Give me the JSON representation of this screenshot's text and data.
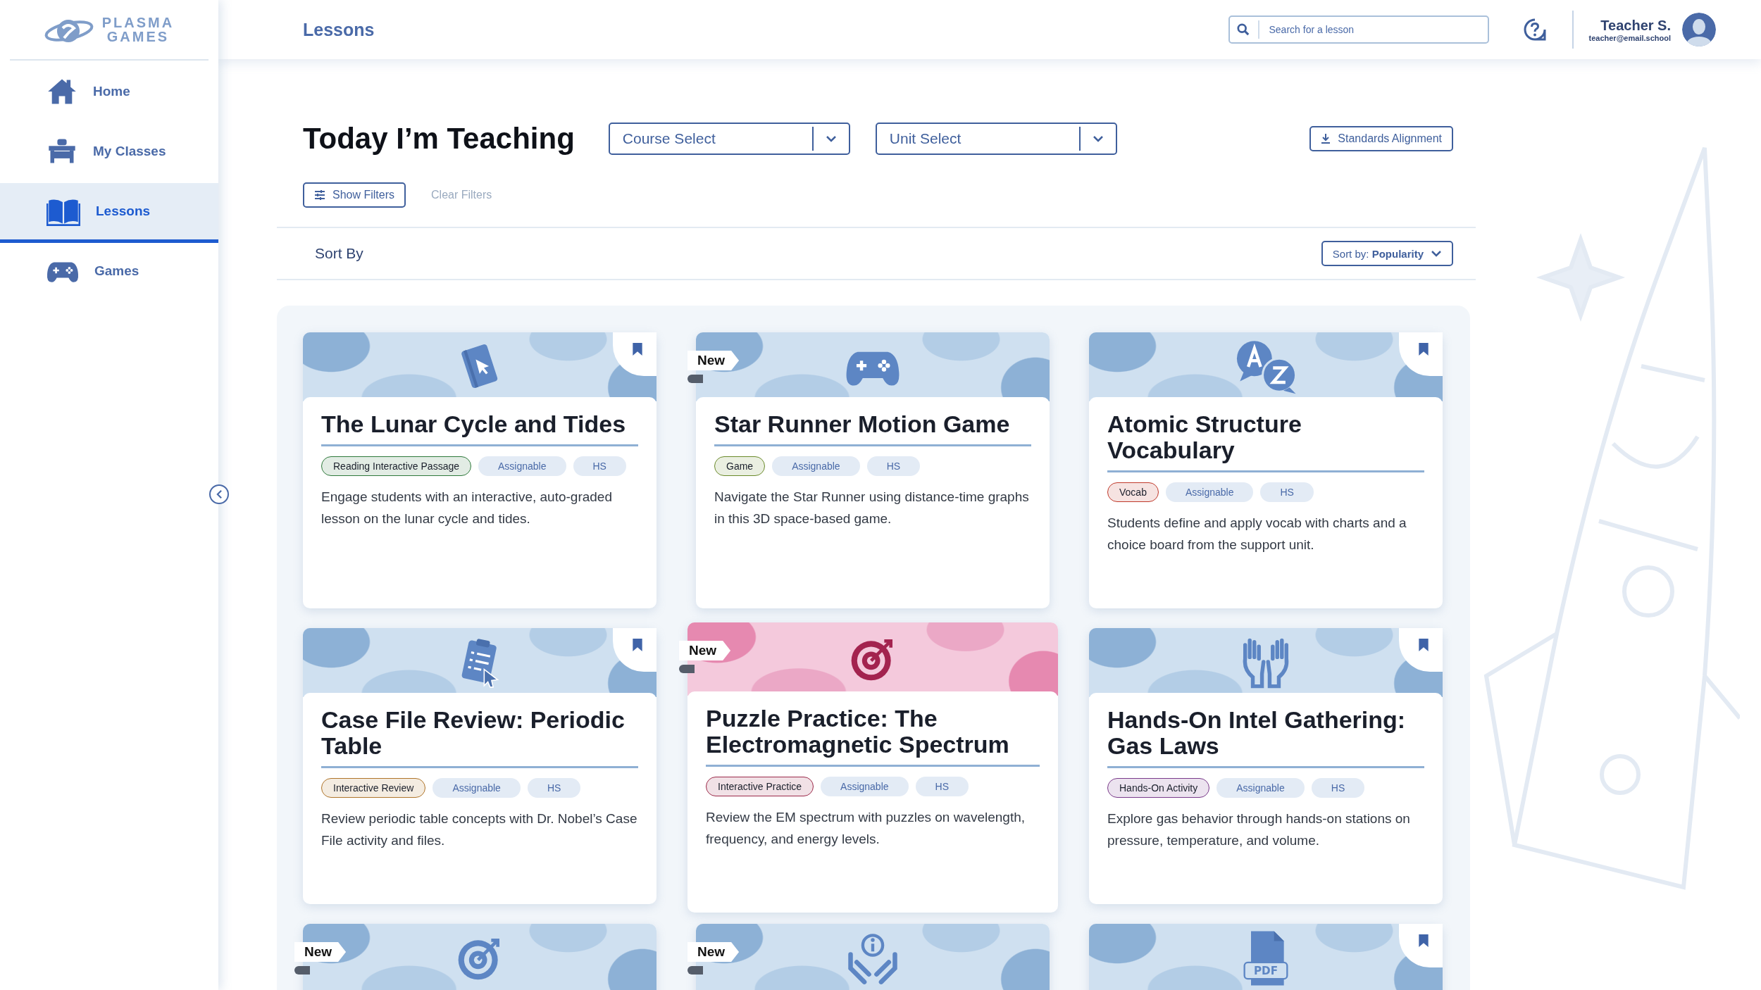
{
  "sidebar": {
    "brand": {
      "line_1": "PLASMA",
      "line_2": "GAMES"
    },
    "items": [
      {
        "label": "Home",
        "kind": "home",
        "selected": false
      },
      {
        "label": "My Classes",
        "kind": "desk",
        "selected": false
      },
      {
        "label": "Lessons",
        "kind": "book",
        "selected": true
      },
      {
        "label": "Games",
        "kind": "gamepad",
        "selected": false
      }
    ]
  },
  "header": {
    "title": "Lessons",
    "search": {
      "placeholder": "Search for a lesson"
    },
    "user": {
      "name": "Teacher S.",
      "email": "teacher@email.school"
    }
  },
  "toolbar": {
    "heading": "Today I’m Teaching",
    "selects": [
      {
        "value": "Course Select"
      },
      {
        "value": "Unit Select"
      }
    ],
    "standards_button": "Standards Alignment",
    "show_filters": "Show Filters",
    "clear_filters": {
      "label": "Clear Filters",
      "disabled": true
    }
  },
  "sort": {
    "label": "Sort By",
    "button": "Sort by: **Popularity**"
  },
  "cards": [
    {
      "kind": "book-cursor",
      "new": false,
      "bookmark": true,
      "featured": false,
      "title": "The Lunar Cycle and Tides",
      "type_tag": {
        "label": "Reading Interactive Passage",
        "color": "#2f7a3c"
      },
      "tags": [
        "Assignable",
        "HS"
      ],
      "description": "Engage students with an interactive, auto-graded lesson on the lunar cycle and tides."
    },
    {
      "kind": "gamepad",
      "new": true,
      "new_label": "New",
      "bookmark": false,
      "featured": false,
      "title": "Star Runner Motion Game",
      "type_tag": {
        "label": "Game",
        "color": "#6a8a2a"
      },
      "tags": [
        "Assignable",
        "HS"
      ],
      "description": "Navigate the Star Runner using distance-time graphs in this 3D space-based game."
    },
    {
      "kind": "az",
      "new": false,
      "bookmark": true,
      "featured": false,
      "title": "Atomic Structure Vocabulary",
      "type_tag": {
        "label": "Vocab",
        "color": "#c0392b"
      },
      "tags": [
        "Assignable",
        "HS"
      ],
      "description": "Students define and apply vocab with charts and a choice board from the support unit."
    },
    {
      "kind": "clipboard",
      "new": false,
      "bookmark": true,
      "featured": false,
      "title": "Case File Review: Periodic Table",
      "type_tag": {
        "label": "Interactive Review",
        "color": "#b0752a"
      },
      "tags": [
        "Assignable",
        "HS"
      ],
      "description": "Review periodic table concepts with Dr. Nobel’s Case File activity and files."
    },
    {
      "kind": "target",
      "new": true,
      "new_label": "New",
      "bookmark": false,
      "featured": true,
      "title": "Puzzle Practice: The Electromagnetic Spectrum",
      "type_tag": {
        "label": "Interactive Practice",
        "color": "#9c2a4a"
      },
      "tags": [
        "Assignable",
        "HS"
      ],
      "description": "Review the EM spectrum with puzzles on wavelength, frequency, and energy levels."
    },
    {
      "kind": "hands",
      "new": false,
      "bookmark": true,
      "featured": false,
      "title": "Hands-On Intel Gathering: Gas Laws",
      "type_tag": {
        "label": "Hands-On Activity",
        "color": "#7a3a8a"
      },
      "tags": [
        "Assignable",
        "HS"
      ],
      "description": "Explore gas behavior through hands-on stations on pressure, temperature, and volume."
    },
    {
      "kind": "target",
      "new": true,
      "new_label": "New",
      "bookmark": false,
      "featured": false
    },
    {
      "kind": "hands-info",
      "new": true,
      "new_label": "New",
      "bookmark": false,
      "featured": false
    },
    {
      "kind": "pdf",
      "icon_text": "PDF",
      "new": false,
      "bookmark": true,
      "featured": false
    }
  ]
}
